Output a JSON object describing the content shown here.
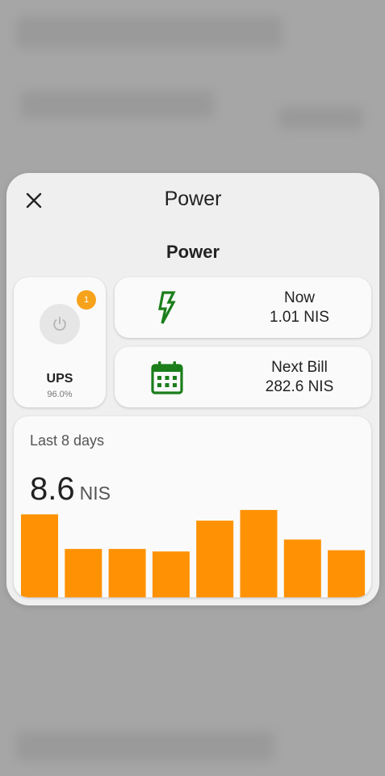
{
  "dialog": {
    "title": "Power",
    "section_title": "Power"
  },
  "ups": {
    "name": "UPS",
    "percent": "96.0%",
    "badge_count": "1",
    "icon": "power-icon"
  },
  "stats": {
    "now": {
      "label": "Now",
      "value": "1.01 NIS",
      "icon": "flash-icon",
      "color": "#1b7e1b"
    },
    "next_bill": {
      "label": "Next Bill",
      "value": "282.6 NIS",
      "icon": "calendar-icon",
      "color": "#1b7e1b"
    }
  },
  "history": {
    "label": "Last 8 days",
    "total": "8.6",
    "unit": "NIS",
    "bar_color": "#ff9204",
    "chart_data": {
      "type": "bar",
      "categories": [
        "",
        "",
        "",
        "",
        "",
        "",
        "",
        ""
      ],
      "values": [
        1.32,
        0.77,
        0.77,
        0.73,
        1.22,
        1.39,
        0.92,
        0.75
      ],
      "xlabel": "",
      "ylabel": "",
      "ylim": [
        0,
        1.8
      ]
    }
  }
}
